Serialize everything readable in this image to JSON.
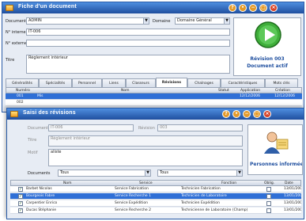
{
  "window1": {
    "title": "Fiche d'un document",
    "fields": {
      "document_label": "Document",
      "document_value": "ADMIN",
      "domaine_label": "Domaine",
      "domaine_value": "Domaine Général",
      "numero_interne_label": "N° interne",
      "numero_interne_value": "IT-006",
      "numero_externe_label": "N° externe",
      "numero_externe_value": "",
      "titre_label": "Titre",
      "titre_value": "Règlement intérieur"
    },
    "revision_panel": {
      "line1": "Révision 003",
      "line2": "Document actif"
    },
    "tabs": [
      "Généralités",
      "Spécialités",
      "Personnel",
      "Liens",
      "Classeurs",
      "Révisions",
      "Chaînages",
      "Caractéristiques",
      "Mots clés"
    ],
    "active_tab": "Révisions",
    "grid_headers": {
      "numero": "Numéro",
      "nom": "Nom",
      "statut": "Statut",
      "application": "Application",
      "creation": "Création"
    },
    "grid_rows": [
      {
        "numero": "001",
        "nom": "Mis",
        "statut": "",
        "application": "12/12/2006",
        "creation": "12/12/2006"
      },
      {
        "numero": "002",
        "nom": "",
        "statut": "",
        "application": "",
        "creation": ""
      }
    ]
  },
  "window2": {
    "title": "Saisi des révisions",
    "fields": {
      "document_label": "Document",
      "document_value": "IT-006",
      "revision_label": "Révision",
      "revision_value": "003",
      "titre_label": "Titre",
      "titre_value": "Règlement intérieur",
      "motif_label": "Motif",
      "motif_value": "aliste",
      "documents_label": "Documents",
      "filter1_value": "Tous",
      "filter2_value": "Tous"
    },
    "person_panel_label": "Personnes informées",
    "grid_headers": {
      "nom": "Nom",
      "service": "Service",
      "fonction": "Fonction",
      "oblig": "Oblig.",
      "date": "Date"
    },
    "grid_rows": [
      {
        "checked": true,
        "nom": "Barbet Nicolas",
        "service": "Service Fabrication",
        "fonction": "Technicien Fabrication",
        "oblig": false,
        "date": "13/01/2007"
      },
      {
        "checked": true,
        "nom": "Bourgeois Fabre",
        "service": "Service Recherche 1",
        "fonction": "Technicien de Laboratoire",
        "oblig": false,
        "date": "13/01/2007"
      },
      {
        "checked": true,
        "nom": "Carpentier Enrico",
        "service": "Service Expédition",
        "fonction": "Technicien Expédition",
        "oblig": false,
        "date": "13/01/2007"
      },
      {
        "checked": true,
        "nom": "Ducas Stéphanie",
        "service": "Service Recherche 2",
        "fonction": "Technicienne de Laboratoire (Champ)",
        "oblig": false,
        "date": "13/01/2007"
      }
    ],
    "selected_row": 1
  }
}
